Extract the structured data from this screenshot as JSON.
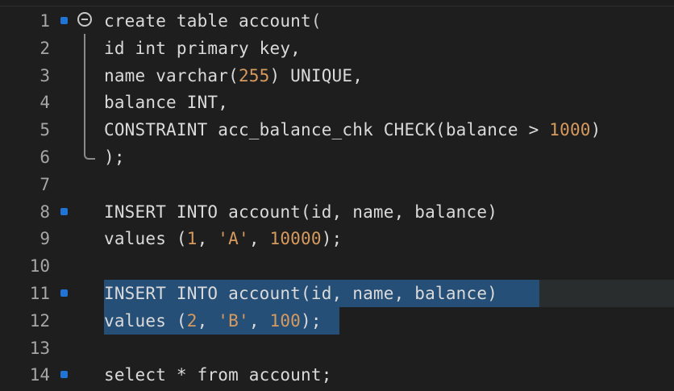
{
  "editor": {
    "lines": [
      {
        "number": "1",
        "tokens": [
          [
            "w",
            "create table account"
          ],
          [
            "p",
            "("
          ]
        ]
      },
      {
        "number": "2",
        "tokens": [
          [
            "w",
            "id int primary key,"
          ]
        ]
      },
      {
        "number": "3",
        "tokens": [
          [
            "w",
            "name varchar("
          ],
          [
            "n",
            "255"
          ],
          [
            "w",
            ") UNIQUE,"
          ]
        ]
      },
      {
        "number": "4",
        "tokens": [
          [
            "w",
            "balance INT,"
          ]
        ]
      },
      {
        "number": "5",
        "tokens": [
          [
            "w",
            "CONSTRAINT acc_balance_chk CHECK(balance > "
          ],
          [
            "n",
            "1000"
          ],
          [
            "w",
            ")"
          ]
        ]
      },
      {
        "number": "6",
        "tokens": [
          [
            "w",
            ");"
          ]
        ]
      },
      {
        "number": "7",
        "tokens": []
      },
      {
        "number": "8",
        "tokens": [
          [
            "w",
            "INSERT INTO account(id, name, balance)"
          ]
        ]
      },
      {
        "number": "9",
        "tokens": [
          [
            "w",
            "values ("
          ],
          [
            "n",
            "1"
          ],
          [
            "w",
            ", "
          ],
          [
            "s",
            "'A'"
          ],
          [
            "w",
            ", "
          ],
          [
            "n",
            "10000"
          ],
          [
            "w",
            ");"
          ]
        ]
      },
      {
        "number": "10",
        "tokens": []
      },
      {
        "number": "11",
        "tokens": [
          [
            "w",
            "INSERT INTO account(id, name, balance)"
          ]
        ]
      },
      {
        "number": "12",
        "tokens": [
          [
            "w",
            "values ("
          ],
          [
            "n",
            "2"
          ],
          [
            "w",
            ", "
          ],
          [
            "s",
            "'B'"
          ],
          [
            "w",
            ", "
          ],
          [
            "n",
            "100"
          ],
          [
            "w",
            ");"
          ]
        ]
      },
      {
        "number": "13",
        "tokens": []
      },
      {
        "number": "14",
        "tokens": [
          [
            "w",
            "select * from account;"
          ]
        ]
      }
    ],
    "dot_lines": [
      "1",
      "8",
      "11",
      "14"
    ],
    "fold_line": "1",
    "selected_lines": [
      "11",
      "12"
    ],
    "colors": {
      "background": "#1e1e1e",
      "selection": "#264f78",
      "line_number": "#a6a6a6",
      "breakpoint_dot": "#1f74d6",
      "number_literal": "#d69a5e",
      "string_literal": "#d69a5e",
      "text": "#dadada"
    },
    "icons": {
      "fold": "fold-collapse-icon",
      "marker": "change-marker-icon"
    }
  }
}
